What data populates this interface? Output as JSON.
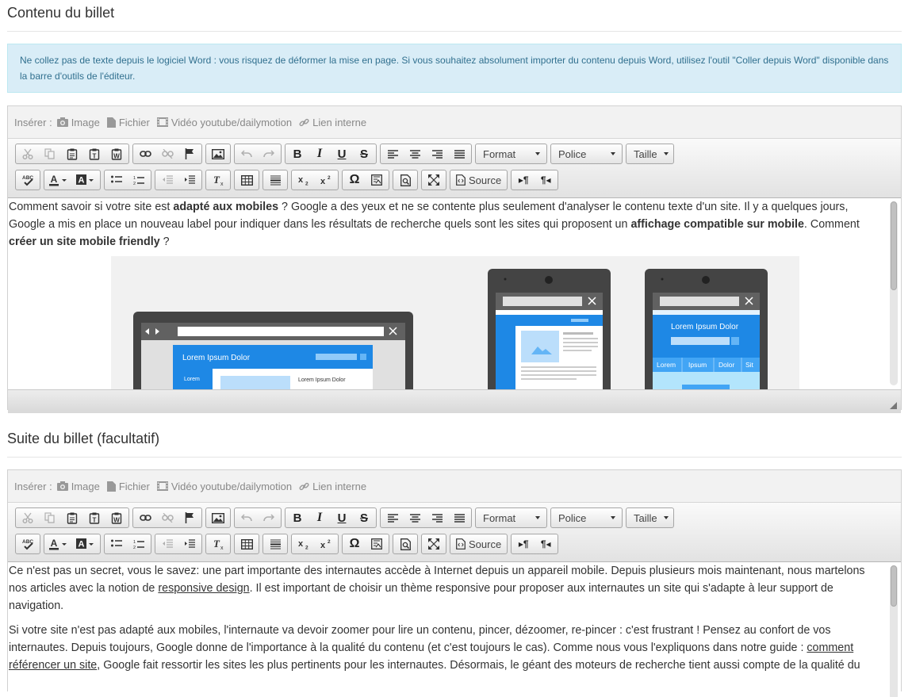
{
  "section1": {
    "title": "Contenu du billet"
  },
  "alert": {
    "text": "Ne collez pas de texte depuis le logiciel Word : vous risquez de déformer la mise en page. Si vous souhaitez absolument importer du contenu depuis Word, utilisez l'outil \"Coller depuis Word\" disponible dans la barre d'outils de l'éditeur."
  },
  "insert_bar": {
    "label": "Insérer :",
    "image": "Image",
    "file": "Fichier",
    "video": "Vidéo youtube/dailymotion",
    "link": "Lien interne"
  },
  "toolbar": {
    "format": "Format",
    "font": "Police",
    "size": "Taille",
    "source": "Source"
  },
  "editor1": {
    "p1_a": "Comment savoir si votre site est ",
    "p1_b": "adapté aux mobiles",
    "p1_c": " ? Google a des yeux et ne se contente plus seulement d'analyser le contenu texte d'un site. Il y a quelques jours, Google a mis en place un nouveau label pour indiquer dans les résultats de recherche quels sont les sites qui proposent un ",
    "p1_d": "affichage compatible sur mobile",
    "p1_e": ". Comment ",
    "p1_f": "créer un site mobile friendly",
    "p1_g": " ?",
    "illus": {
      "laptop_title": "Lorem Ipsum Dolor",
      "laptop_menu": "Lorem",
      "laptop_sub": "Lorem Ipsum Dolor",
      "phone2_title": "Lorem Ipsum Dolor",
      "phone2_tabs": [
        "Lorem",
        "Ipsum",
        "Dolor",
        "Sit"
      ]
    }
  },
  "section2": {
    "title": "Suite du billet (facultatif)"
  },
  "editor2": {
    "p1_a": "Ce n'est pas un secret, vous le savez: une part importante des internautes accède à Internet depuis un appareil mobile. Depuis plusieurs mois maintenant, nous martelons nos articles avec la notion de ",
    "p1_link": "responsive design",
    "p1_b": ". Il est important de choisir un thème responsive pour proposer aux internautes un site qui s'adapte à leur support de navigation.",
    "p2_a": "Si votre site n'est pas adapté aux mobiles, l'internaute va devoir zoomer pour lire un contenu, pincer, dézoomer, re-pincer : c'est frustrant ! Pensez au confort de vos internautes. Depuis toujours, Google donne de l'importance à la qualité du contenu (et c'est toujours le cas). Comme nous vous l'expliquons dans notre guide : ",
    "p2_link": "comment référencer un site",
    "p2_b": ", Google fait ressortir les sites les plus pertinents pour les internautes. Désormais, le géant des moteurs de recherche tient aussi compte de la qualité du"
  },
  "colors": {
    "alert_bg": "#d9edf7",
    "alert_text": "#31708f",
    "illus_blue": "#1e88e5"
  }
}
